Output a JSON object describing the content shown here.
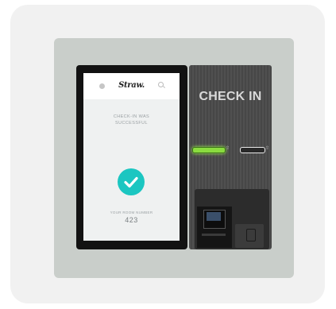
{
  "screen": {
    "brand": "Straw.",
    "message_line1": "CHECK-IN WAS",
    "message_line2": "SUCCESSFUL",
    "room_label": "YOUR ROOM NUMBER",
    "room_number": "423"
  },
  "kiosk": {
    "title": "CHECK IN",
    "card_symbol": "⇧",
    "nfc_symbol": "⇧"
  },
  "colors": {
    "accent_teal": "#1bc6c1",
    "slot_green": "#8adb3f"
  },
  "icons": [
    "menu-dot-icon",
    "search-icon",
    "checkmark-icon",
    "card-reader-icon",
    "nfc-icon"
  ]
}
